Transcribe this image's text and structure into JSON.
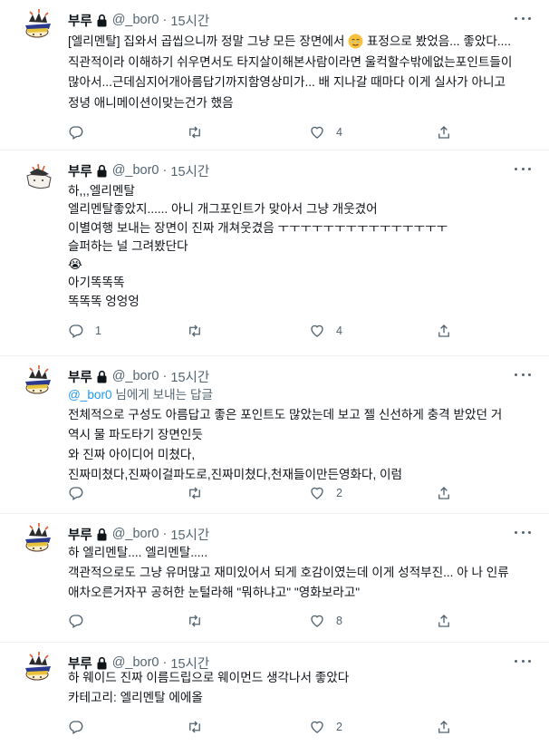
{
  "tweets": [
    {
      "name": "부루",
      "handle": "@_bor0",
      "time": "15시간",
      "lines": [
        [
          "[엘리멘탈] 집와서 곱씹으니까 정말 그냥 모든 장면에서 ",
          "🥲",
          " 표정으로 봤었음... 좋았다...."
        ],
        [
          "직관적이라 이해하기 쉬우면서도 타지살이해본사람이라면 울컥할수밖에없는포인트들이"
        ],
        [
          "많아서...근데심지어개아름답기까지함영상미가... 배 지나갈 때마다 이게 실사가 아니고"
        ],
        [
          "정녕 애니메이션이맞는건가 했음"
        ]
      ],
      "reply": "",
      "retweet": "",
      "like": "4"
    },
    {
      "name": "부루",
      "handle": "@_bor0",
      "time": "15시간",
      "lines": [
        [
          "하,,,엘리멘탈"
        ],
        [
          "엘리멘탈좋았지...... 아니 개그포인트가 맞아서 그냥 개웃겼어"
        ],
        [
          "이별여행 보내는 장면이 진짜 개쳐웃겼음 ㅜㅜㅜㅜㅜㅜㅜㅜㅜㅜㅜㅜㅜㅜㅜ"
        ],
        [
          "슬퍼하는 널 그려봤단다"
        ],
        [
          "😭"
        ],
        [
          "아기똑똑똑"
        ],
        [
          "똑똑똑 엉엉엉"
        ]
      ],
      "reply": "1",
      "retweet": "",
      "like": "4"
    },
    {
      "name": "부루",
      "handle": "@_bor0",
      "time": "15시간",
      "reply_to_mention": "@_bor0",
      "reply_to_text": " 님에게 보내는 답글",
      "lines": [
        [
          "전체적으로 구성도 아름답고 좋은 포인트도 많았는데 보고 젤 신선하게 충격 받았던 거"
        ],
        [
          "역시 물 파도타기 장면인듯"
        ],
        [
          "와 진짜 아이디어 미쳤다,"
        ],
        [
          "진짜미쳤다,진짜이걸파도로,진짜미쳤다,천재들이만든영화다, 이럼"
        ]
      ],
      "reply": "",
      "retweet": "",
      "like": "2"
    },
    {
      "name": "부루",
      "handle": "@_bor0",
      "time": "15시간",
      "lines": [
        [
          "하 엘리멘탈.... 엘리멘탈....."
        ],
        [
          "객관적으로도 그냥 유머많고 재미있어서 되게 호감이였는데 이게 성적부진... 아 나 인류"
        ],
        [
          "애차오른거자꾸 공허한 눈털라해 \"뭐하냐고\" \"영화보라고\""
        ]
      ],
      "reply": "",
      "retweet": "",
      "like": "8"
    },
    {
      "name": "부루",
      "handle": "@_bor0",
      "time": "15시간",
      "lines": [
        [
          "하 웨이드 진짜 이름드립으로 웨이먼드 생각나서 좋았다"
        ],
        [
          "카테고리: 엘리멘탈 에에올"
        ]
      ],
      "reply": "",
      "retweet": "",
      "like": "2"
    }
  ]
}
